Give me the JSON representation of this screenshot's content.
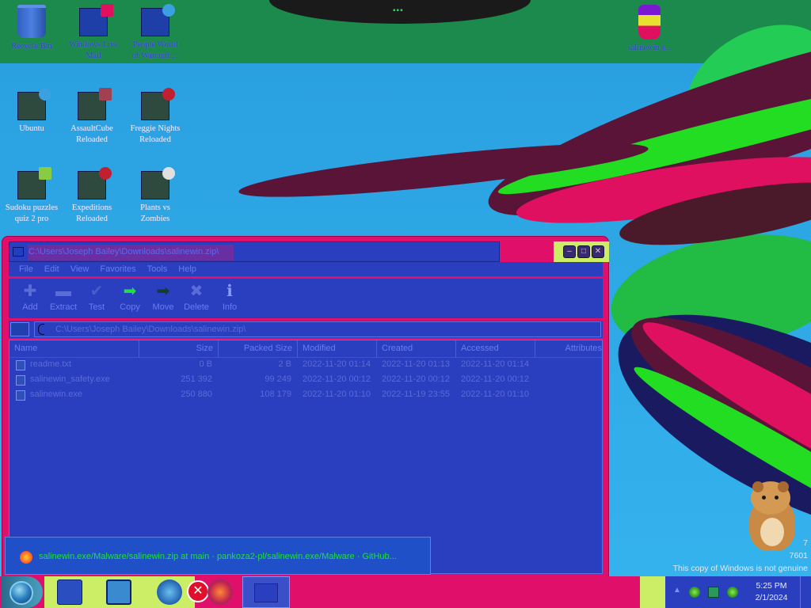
{
  "desktop": {
    "icons": [
      {
        "label_1": "Recycle Bin",
        "label_2": ""
      },
      {
        "label_1": "Windows Live",
        "label_2": "Mail"
      },
      {
        "label_1": "People World",
        "label_2": "of Warcraft ..."
      },
      {
        "label_1": "Ubuntu",
        "label_2": ""
      },
      {
        "label_1": "AssaultCube",
        "label_2": "Reloaded"
      },
      {
        "label_1": "Freggie Nights",
        "label_2": "Reloaded"
      },
      {
        "label_1": "Sudoku puzzles",
        "label_2": "quiz 2 pro"
      },
      {
        "label_1": "Expeditions",
        "label_2": "Reloaded"
      },
      {
        "label_1": "Plants vs",
        "label_2": "Zombies"
      },
      {
        "label_1": "salinewin s...",
        "label_2": ""
      }
    ]
  },
  "window": {
    "title": "C:\\Users\\Joseph Bailey\\Downloads\\salinewin.zip\\",
    "menu": [
      "File",
      "Edit",
      "View",
      "Favorites",
      "Tools",
      "Help"
    ],
    "toolbar": [
      {
        "label": "Add",
        "icon": "plus-icon",
        "glyph": "✚",
        "color": "#5a6cd8"
      },
      {
        "label": "Extract",
        "icon": "minus-icon",
        "glyph": "▬",
        "color": "#5a6cd8"
      },
      {
        "label": "Test",
        "icon": "check-icon",
        "glyph": "✔",
        "color": "#4a5cc8"
      },
      {
        "label": "Copy",
        "icon": "copy-arrow-icon",
        "glyph": "➡",
        "color": "#22dd44"
      },
      {
        "label": "Move",
        "icon": "move-arrow-icon",
        "glyph": "➡",
        "color": "#1a3a2a"
      },
      {
        "label": "Delete",
        "icon": "delete-x-icon",
        "glyph": "✖",
        "color": "#5a6cd8"
      },
      {
        "label": "Info",
        "icon": "info-icon",
        "glyph": "ℹ",
        "color": "#8a9cf8"
      }
    ],
    "address": "C:\\Users\\Joseph Bailey\\Downloads\\salinewin.zip\\",
    "columns": [
      "Name",
      "Size",
      "Packed Size",
      "Modified",
      "Created",
      "Accessed",
      "Attributes"
    ],
    "files": [
      {
        "name": "readme.txt",
        "size": "0 B",
        "packed": "2 B",
        "modified": "2022-11-20 01:14",
        "created": "2022-11-20 01:13",
        "accessed": "2022-11-20 01:14"
      },
      {
        "name": "salinewin_safety.exe",
        "size": "251 392",
        "packed": "99 249",
        "modified": "2022-11-20 00:12",
        "created": "2022-11-20 00:12",
        "accessed": "2022-11-20 00:12"
      },
      {
        "name": "salinewin.exe",
        "size": "250 880",
        "packed": "108 179",
        "modified": "2022-11-20 01:10",
        "created": "2022-11-19 23:55",
        "accessed": "2022-11-20 01:10"
      }
    ]
  },
  "toast": {
    "text": "salinewin.exe/Malware/salinewin.zip at main · pankoza2-pl/salinewin.exe/Malware · GitHub..."
  },
  "watermark": {
    "line1": "7",
    "line2": "7601",
    "line3": "This copy of Windows is not genuine"
  },
  "taskbar": {
    "clock_time": "5:25 PM",
    "clock_date": "2/1/2024"
  },
  "colors": {
    "window_blue": "#2a3ec0",
    "frame_magenta": "#e0106a",
    "accent_yellow": "#ccee66"
  }
}
